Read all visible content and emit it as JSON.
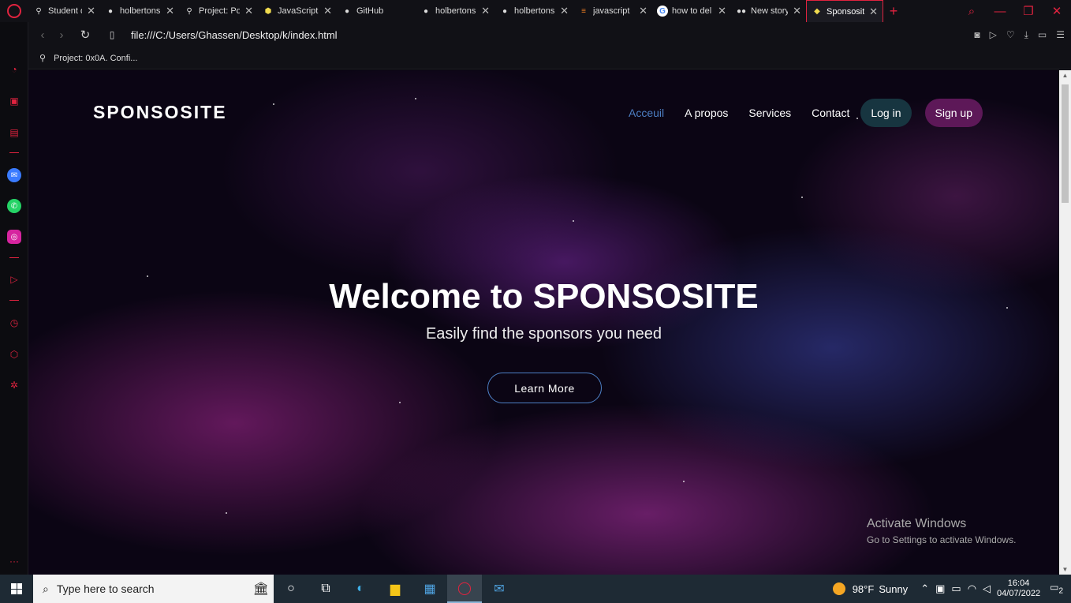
{
  "browser": {
    "tabs": [
      {
        "title": "Student da",
        "icon": "holberton-icon"
      },
      {
        "title": "holbertons",
        "icon": "github-icon"
      },
      {
        "title": "Project: Po",
        "icon": "holberton-icon"
      },
      {
        "title": "JavaScript",
        "icon": "js-icon"
      },
      {
        "title": "GitHub",
        "icon": "github-icon"
      },
      {
        "title": "holbertons",
        "icon": "github-icon"
      },
      {
        "title": "holbertons",
        "icon": "github-icon"
      },
      {
        "title": "javascript",
        "icon": "stackoverflow-icon"
      },
      {
        "title": "how to del",
        "icon": "google-icon"
      },
      {
        "title": "New story",
        "icon": "medium-icon"
      },
      {
        "title": "Sponsosite",
        "icon": "sponsosite-icon"
      }
    ],
    "url": "file:///C:/Users/Ghassen/Desktop/k/index.html",
    "bookmark": "Project: 0x0A. Confi...",
    "accent": "#e0233f"
  },
  "site": {
    "brand": "SPONSOSITE",
    "nav": {
      "accueil": "Acceuil",
      "apropos": "A propos",
      "services": "Services",
      "contact": "Contact",
      "login": "Log in",
      "signup": "Sign up"
    },
    "hero": {
      "title": "Welcome to SPONSOSITE",
      "subtitle": "Easily find the sponsors you need",
      "cta": "Learn More"
    }
  },
  "watermark": {
    "line1": "Activate Windows",
    "line2": "Go to Settings to activate Windows."
  },
  "taskbar": {
    "search_placeholder": "Type here to search",
    "weather_temp": "98°F",
    "weather_desc": "Sunny",
    "time": "16:04",
    "date": "04/07/2022",
    "notifications": "2"
  }
}
